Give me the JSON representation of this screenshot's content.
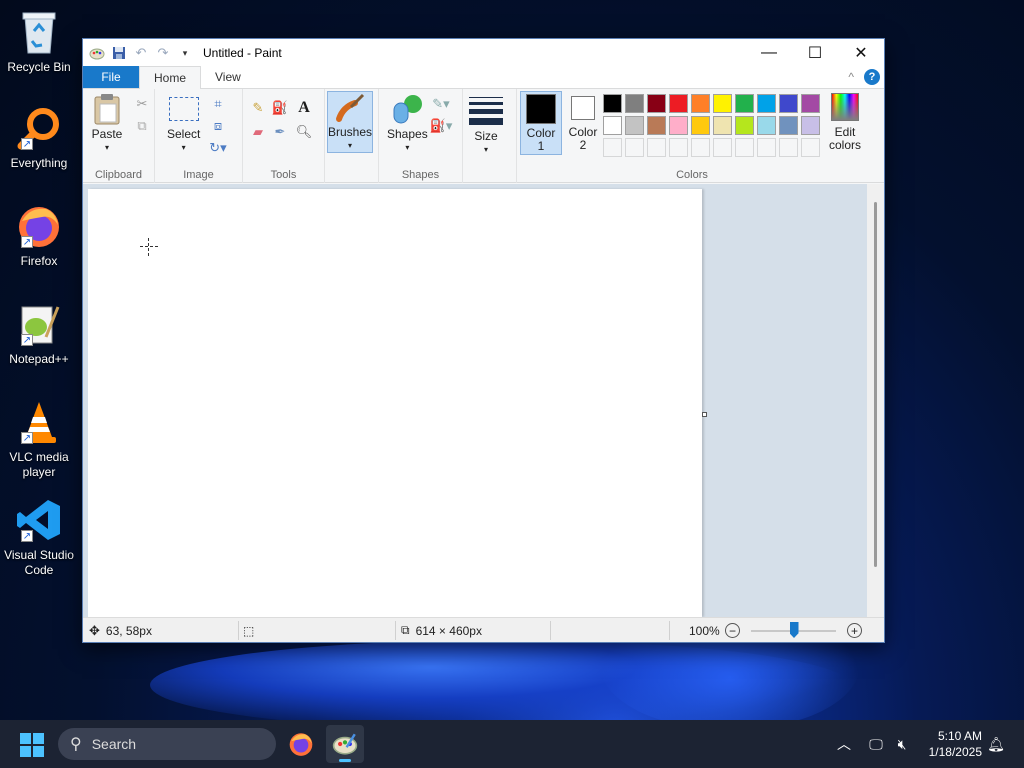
{
  "desktop": {
    "icons": [
      {
        "label": "Recycle Bin",
        "icon": "recycle-bin-icon"
      },
      {
        "label": "Everything",
        "icon": "everything-search-icon"
      },
      {
        "label": "Firefox",
        "icon": "firefox-icon"
      },
      {
        "label": "Notepad++",
        "icon": "notepadpp-icon"
      },
      {
        "label": "VLC media player",
        "icon": "vlc-icon"
      },
      {
        "label": "Visual Studio Code",
        "icon": "vscode-icon"
      }
    ]
  },
  "window": {
    "title": "Untitled - Paint",
    "controls": {
      "minimize": "—",
      "maximize": "☐",
      "close": "✕"
    },
    "tabs": {
      "file": "File",
      "home": "Home",
      "view": "View"
    },
    "collapse": "^",
    "help": "?"
  },
  "ribbon": {
    "clipboard": {
      "group": "Clipboard",
      "paste": "Paste"
    },
    "image": {
      "group": "Image",
      "select": "Select"
    },
    "tools": {
      "group": "Tools"
    },
    "brushes": {
      "label": "Brushes"
    },
    "shapes": {
      "group": "Shapes",
      "label": "Shapes"
    },
    "size": {
      "label": "Size"
    },
    "colors": {
      "group": "Colors",
      "color1": "Color 1",
      "color2": "Color 2",
      "edit": "Edit colors",
      "color1_value": "#000000",
      "color2_value": "#ffffff",
      "row1": [
        "#000000",
        "#7f7f7f",
        "#880015",
        "#ed1c24",
        "#ff7f27",
        "#fff200",
        "#22b14c",
        "#00a2e8",
        "#3f48cc",
        "#a349a4"
      ],
      "row2": [
        "#ffffff",
        "#c3c3c3",
        "#b97a57",
        "#ffaec9",
        "#ffc90e",
        "#efe4b0",
        "#b5e61d",
        "#99d9ea",
        "#7092be",
        "#c8bfe7"
      ]
    }
  },
  "status": {
    "cursor_pos": "63, 58px",
    "canvas_size": "614 × 460px",
    "zoom": "100%",
    "zoom_level": 0.5
  },
  "taskbar": {
    "search_placeholder": "Search",
    "time": "5:10 AM",
    "date": "1/18/2025"
  }
}
